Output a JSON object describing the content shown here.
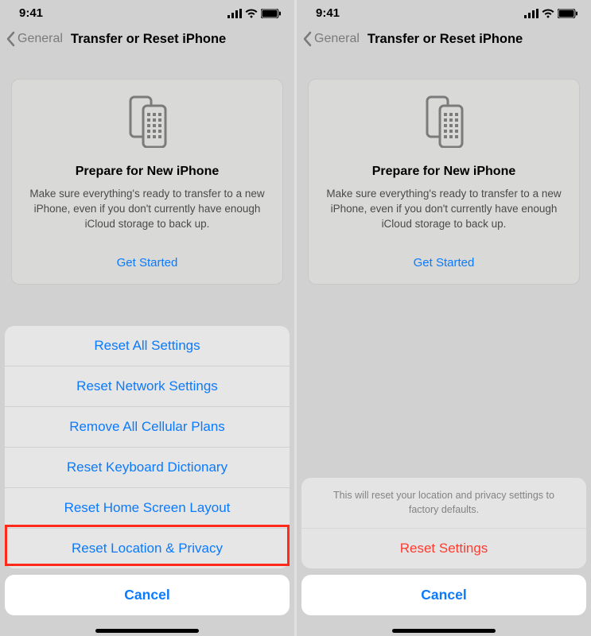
{
  "status": {
    "time": "9:41"
  },
  "nav": {
    "back": "General",
    "title": "Transfer or Reset iPhone"
  },
  "card": {
    "title": "Prepare for New iPhone",
    "desc": "Make sure everything's ready to transfer to a new iPhone, even if you don't currently have enough iCloud storage to back up.",
    "link": "Get Started"
  },
  "left_sheet": {
    "items": [
      "Reset All Settings",
      "Reset Network Settings",
      "Remove All Cellular Plans",
      "Reset Keyboard Dictionary",
      "Reset Home Screen Layout",
      "Reset Location & Privacy"
    ],
    "cancel": "Cancel"
  },
  "right_sheet": {
    "message": "This will reset your location and privacy settings to factory defaults.",
    "action": "Reset Settings",
    "cancel": "Cancel"
  }
}
